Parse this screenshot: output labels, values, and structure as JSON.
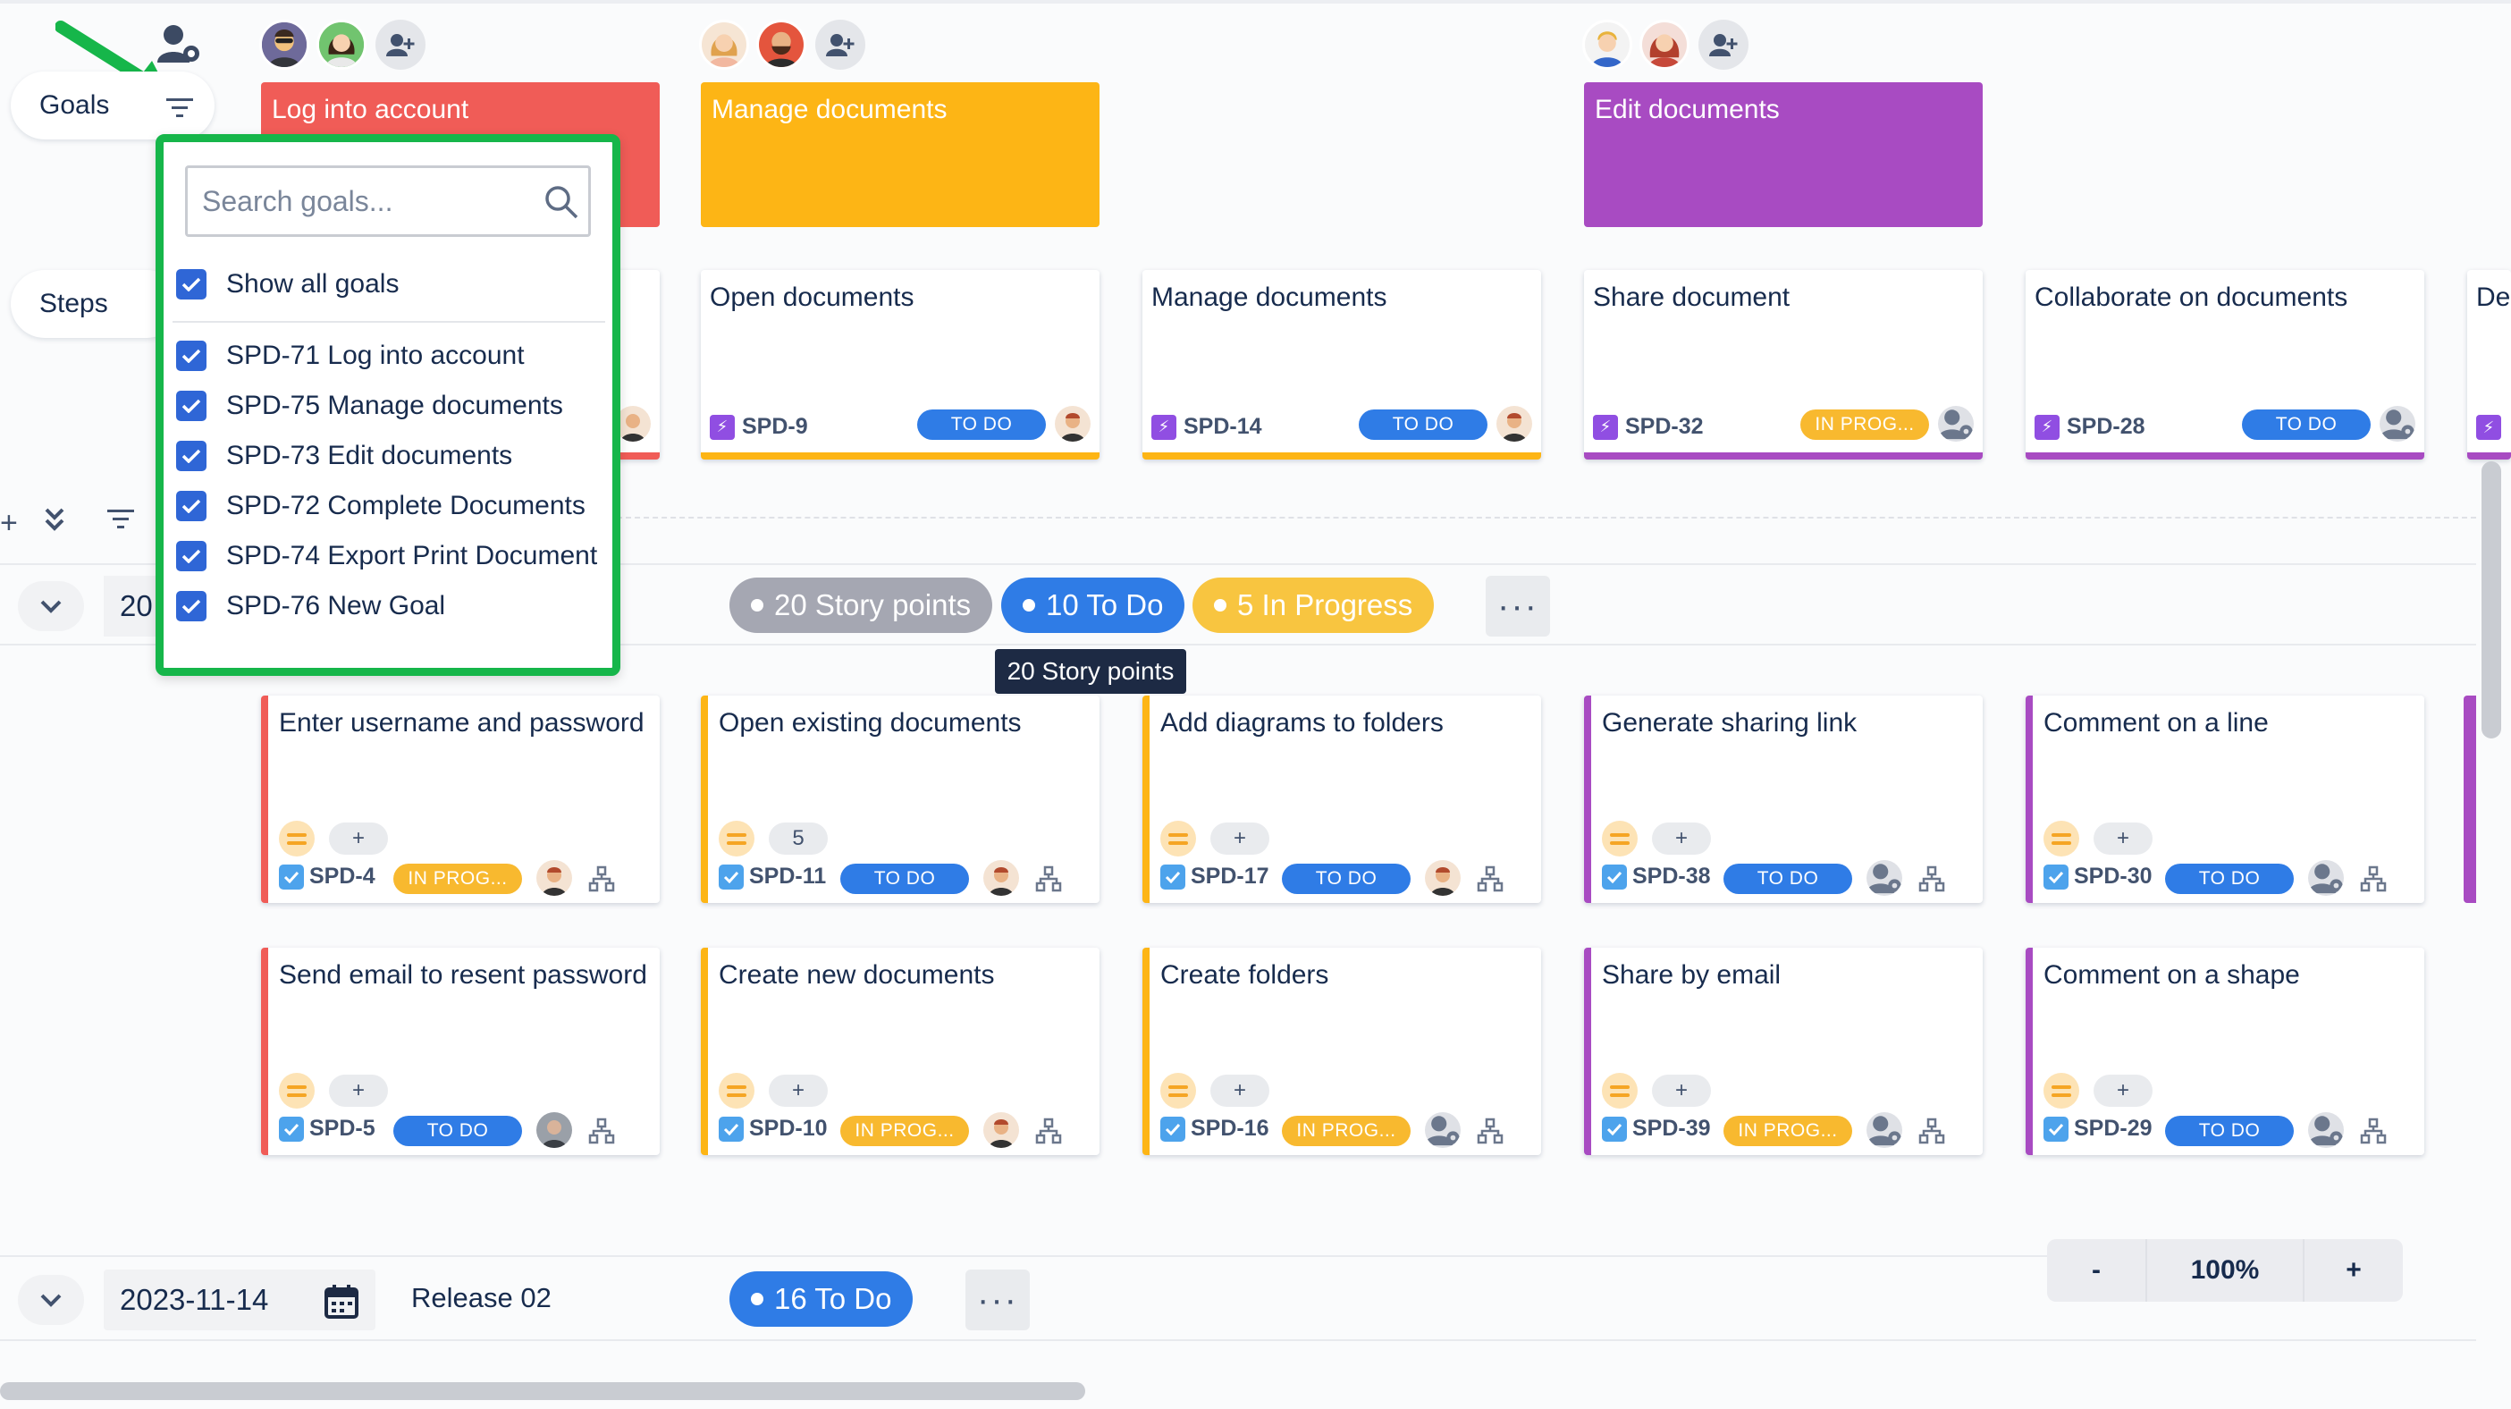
{
  "sidebar": {
    "goals_label": "Goals",
    "steps_label": "Steps"
  },
  "goals": [
    {
      "title": "Log into account",
      "color": "#f05c57"
    },
    {
      "title": "Manage documents",
      "color": "#fdb515"
    },
    {
      "title": "Edit documents",
      "color": "#a84bc2"
    }
  ],
  "steps": [
    {
      "title": "Open documents",
      "key": "SPD-9",
      "status": "TO DO",
      "accent": "#fdb515"
    },
    {
      "title": "Manage documents",
      "key": "SPD-14",
      "status": "TO DO",
      "accent": "#fdb515"
    },
    {
      "title": "Share document",
      "key": "SPD-32",
      "status": "IN PROG...",
      "accent": "#a84bc2"
    },
    {
      "title": "Collaborate on documents",
      "key": "SPD-28",
      "status": "TO DO",
      "accent": "#a84bc2"
    },
    {
      "title": "De"
    }
  ],
  "goal_filter": {
    "search_placeholder": "Search goals...",
    "show_all": "Show all goals",
    "options": [
      "SPD-71 Log into account",
      "SPD-75 Manage documents",
      "SPD-73 Edit documents",
      "SPD-72 Complete Documents",
      "SPD-74 Export Print Document",
      "SPD-76 New Goal"
    ]
  },
  "release1": {
    "date_partial": "20",
    "story_points": "20 Story points",
    "todo": "10 To Do",
    "in_progress": "5 In Progress",
    "tooltip": "20 Story points"
  },
  "stories_row1": [
    {
      "title": "Enter username and password",
      "key": "SPD-4",
      "status": "IN PROG...",
      "points": "+",
      "accent": "#f05c57"
    },
    {
      "title": "Open existing documents",
      "key": "SPD-11",
      "status": "TO DO",
      "points": "5",
      "accent": "#fdb515"
    },
    {
      "title": "Add diagrams to folders",
      "key": "SPD-17",
      "status": "TO DO",
      "points": "+",
      "accent": "#fdb515"
    },
    {
      "title": "Generate sharing link",
      "key": "SPD-38",
      "status": "TO DO",
      "points": "+",
      "accent": "#a84bc2"
    },
    {
      "title": "Comment on a line",
      "key": "SPD-30",
      "status": "TO DO",
      "points": "+",
      "accent": "#a84bc2"
    }
  ],
  "stories_row2": [
    {
      "title": "Send email to resent password",
      "key": "SPD-5",
      "status": "TO DO",
      "points": "+",
      "accent": "#f05c57"
    },
    {
      "title": "Create new documents",
      "key": "SPD-10",
      "status": "IN PROG...",
      "points": "+",
      "accent": "#fdb515"
    },
    {
      "title": "Create folders",
      "key": "SPD-16",
      "status": "IN PROG...",
      "points": "+",
      "accent": "#fdb515"
    },
    {
      "title": "Share by email",
      "key": "SPD-39",
      "status": "IN PROG...",
      "points": "+",
      "accent": "#a84bc2"
    },
    {
      "title": "Comment on a shape",
      "key": "SPD-29",
      "status": "TO DO",
      "points": "+",
      "accent": "#a84bc2"
    }
  ],
  "release2": {
    "date": "2023-11-14",
    "name": "Release 02",
    "todo": "16 To Do"
  },
  "zoom": {
    "minus": "-",
    "level": "100%",
    "plus": "+"
  },
  "controls": {
    "add": "+",
    "more": "···"
  },
  "colors": {
    "todo": "#2f7ce6",
    "in_progress": "#f8b92f",
    "story_points": "#a5a7b2",
    "highlight": "#16b64a"
  }
}
